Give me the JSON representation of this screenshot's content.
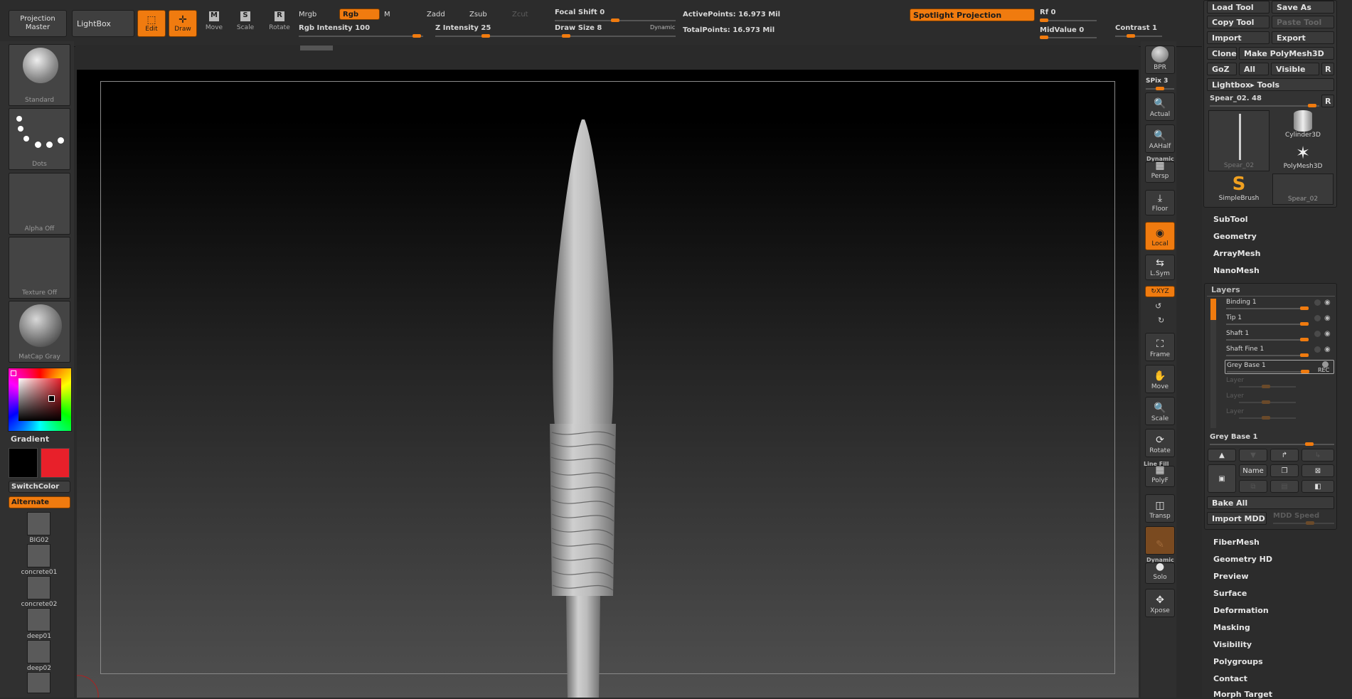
{
  "top": {
    "projection_master": "Projection\nMaster",
    "lightbox": "LightBox",
    "edit": "Edit",
    "draw": "Draw",
    "move": "Move",
    "scale": "Scale",
    "rotate": "Rotate",
    "mrgb": "Mrgb",
    "rgb": "Rgb",
    "m": "M",
    "zadd": "Zadd",
    "zsub": "Zsub",
    "zcut": "Zcut",
    "rgb_intensity": "Rgb  Intensity 100",
    "z_intensity": "Z  Intensity 25",
    "focal_shift": "Focal  Shift 0",
    "draw_size": "Draw  Size 8",
    "dynamic": "Dynamic",
    "active_points": "ActivePoints: 16.973  Mil",
    "total_points": "TotalPoints: 16.973  Mil",
    "spotlight": "Spotlight  Projection",
    "rf": "Rf 0",
    "midvalue": "MidValue 0",
    "contrast": "Contrast 1"
  },
  "left": {
    "brush": "Standard",
    "stroke": "Dots",
    "alpha": "Alpha  Off",
    "texture": "Texture  Off",
    "material": "MatCap  Gray",
    "gradient": "Gradient",
    "switchcolor": "SwitchColor",
    "alternate": "Alternate",
    "alphas": [
      "BIG02",
      "concrete01",
      "concrete02",
      "deep01",
      "deep02"
    ],
    "main_color": "#000000",
    "secondary_color": "#e8202a"
  },
  "shelf": {
    "bpr": "BPR",
    "spix": "SPix 3",
    "actual": "Actual",
    "aahalf": "AAHalf",
    "dynamic": "Dynamic",
    "persp": "Persp",
    "floor": "Floor",
    "local": "Local",
    "lsym": "L.Sym",
    "xyz": "XYZ",
    "frame": "Frame",
    "move": "Move",
    "scale": "Scale",
    "rotate": "Rotate",
    "linefill": "Line Fill",
    "polyf": "PolyF",
    "transp": "Transp",
    "dynamic2": "Dynamic",
    "solo": "Solo",
    "xpose": "Xpose"
  },
  "right": {
    "load_tool": "Load Tool",
    "save_as": "Save As",
    "copy_tool": "Copy Tool",
    "paste_tool": "Paste Tool",
    "import": "Import",
    "export": "Export",
    "clone": "Clone",
    "make_polymesh": "Make PolyMesh3D",
    "goz": "GoZ",
    "all": "All",
    "visible": "Visible",
    "r": "R",
    "lightbox_tools": "Lightbox▸ Tools",
    "tool_name": "Spear_02. 48",
    "tools": [
      "Spear_02",
      "Cylinder3D",
      "PolyMesh3D",
      "SimpleBrush",
      "Spear_02"
    ],
    "menus_top": [
      "SubTool",
      "Geometry",
      "ArrayMesh",
      "NanoMesh"
    ],
    "layers_title": "Layers",
    "layers": [
      "Binding 1",
      "Tip 1",
      "Shaft 1",
      "Shaft  Fine 1",
      "Grey  Base 1"
    ],
    "empty_layers": [
      "Layer",
      "Layer",
      "Layer"
    ],
    "rec": "REC",
    "selected_layer": "Grey  Base 1",
    "name_btn": "Name",
    "bake_all": "Bake  All",
    "import_mdd": "Import  MDD",
    "mdd_speed": "MDD  Speed",
    "menus_bottom": [
      "FiberMesh",
      "Geometry HD",
      "Preview",
      "Surface",
      "Deformation",
      "Masking",
      "Visibility",
      "Polygroups",
      "Contact",
      "Morph Target"
    ]
  }
}
